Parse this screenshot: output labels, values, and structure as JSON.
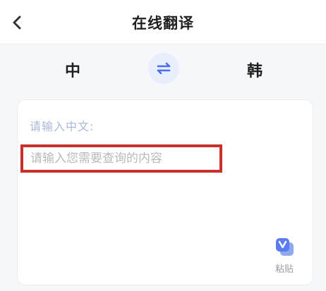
{
  "header": {
    "title": "在线翻译",
    "back_icon": "chevron-left-icon"
  },
  "languages": {
    "source": "中",
    "target": "韩",
    "swap_icon": "swap-arrows-icon"
  },
  "input_card": {
    "hint": "请输入中文:",
    "placeholder": "请输入您需要查询的内容",
    "value": "",
    "paste_label": "粘贴",
    "paste_icon": "paste-icon"
  },
  "colors": {
    "accent": "#4a6cf7",
    "hint": "#a8b8d8",
    "highlight_border": "#c9302c",
    "swap_bg": "#e8eefb"
  }
}
